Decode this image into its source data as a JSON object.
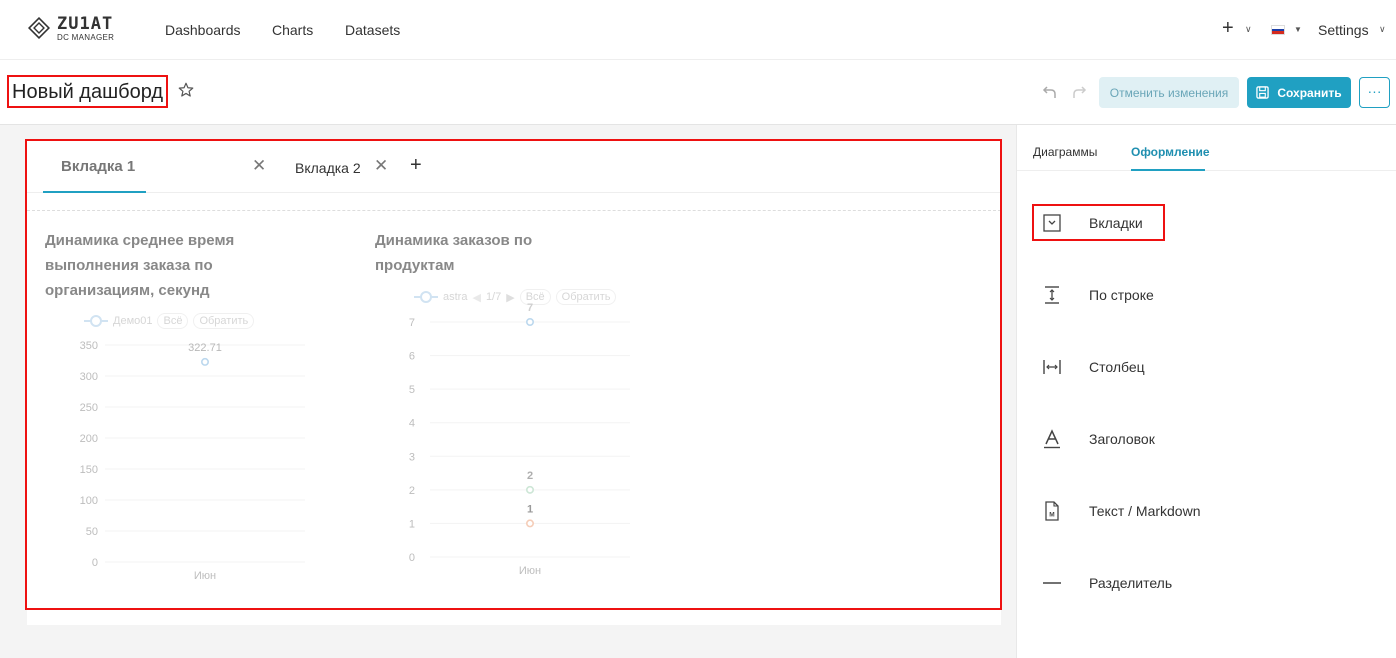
{
  "brand": {
    "name": "ZU1AT",
    "subtitle": "DC MANAGER"
  },
  "nav": {
    "items": [
      "Dashboards",
      "Charts",
      "Datasets"
    ],
    "settings": "Settings"
  },
  "flag_colors": [
    "#ffffff",
    "#1c3fa8",
    "#d52b1e"
  ],
  "header": {
    "title": "Новый дашборд",
    "discard_label": "Отменить изменения",
    "save_label": "Сохранить",
    "more_label": "···"
  },
  "tabs": [
    {
      "label": "Вкладка 1",
      "active": true
    },
    {
      "label": "Вкладка 2",
      "active": false
    }
  ],
  "charts": [
    {
      "title_lines": [
        "Динамика среднее время",
        "выполнения заказа по",
        "организациям, секунд"
      ],
      "legend": {
        "series": "Демо01",
        "all": "Всё",
        "invert": "Обратить"
      },
      "chart_data": {
        "type": "line",
        "categories": [
          "Июн"
        ],
        "series": [
          {
            "name": "Демо01",
            "values": [
              322.71
            ]
          }
        ],
        "data_labels": [
          "322.71"
        ],
        "yticks": [
          "0",
          "50",
          "100",
          "150",
          "200",
          "250",
          "300",
          "350"
        ],
        "ylim": [
          0,
          350
        ]
      }
    },
    {
      "title_lines": [
        "Динамика заказов по",
        "продуктам"
      ],
      "legend": {
        "series": "astra",
        "pager": "1/7",
        "all": "Всё",
        "invert": "Обратить"
      },
      "chart_data": {
        "type": "line",
        "categories": [
          "Июн"
        ],
        "series": [
          {
            "name": "astra",
            "values": [
              7
            ]
          },
          {
            "values": [
              2
            ]
          },
          {
            "values": [
              1
            ]
          }
        ],
        "data_labels": [
          "7",
          "2",
          "1"
        ],
        "yticks": [
          "0",
          "1",
          "2",
          "3",
          "4",
          "5",
          "6",
          "7"
        ],
        "ylim": [
          0,
          7
        ]
      }
    }
  ],
  "panel": {
    "tabs": [
      "Диаграммы",
      "Оформление"
    ],
    "active_tab": "Оформление",
    "items": [
      {
        "label": "Вкладки",
        "icon": "tabs-icon"
      },
      {
        "label": "По строке",
        "icon": "row-height-icon"
      },
      {
        "label": "Столбец",
        "icon": "column-width-icon"
      },
      {
        "label": "Заголовок",
        "icon": "heading-icon"
      },
      {
        "label": "Текст / Markdown",
        "icon": "markdown-icon"
      },
      {
        "label": "Разделитель",
        "icon": "divider-icon"
      }
    ]
  },
  "colors": {
    "accent": "#20a0c2",
    "highlight": "#e11111"
  }
}
